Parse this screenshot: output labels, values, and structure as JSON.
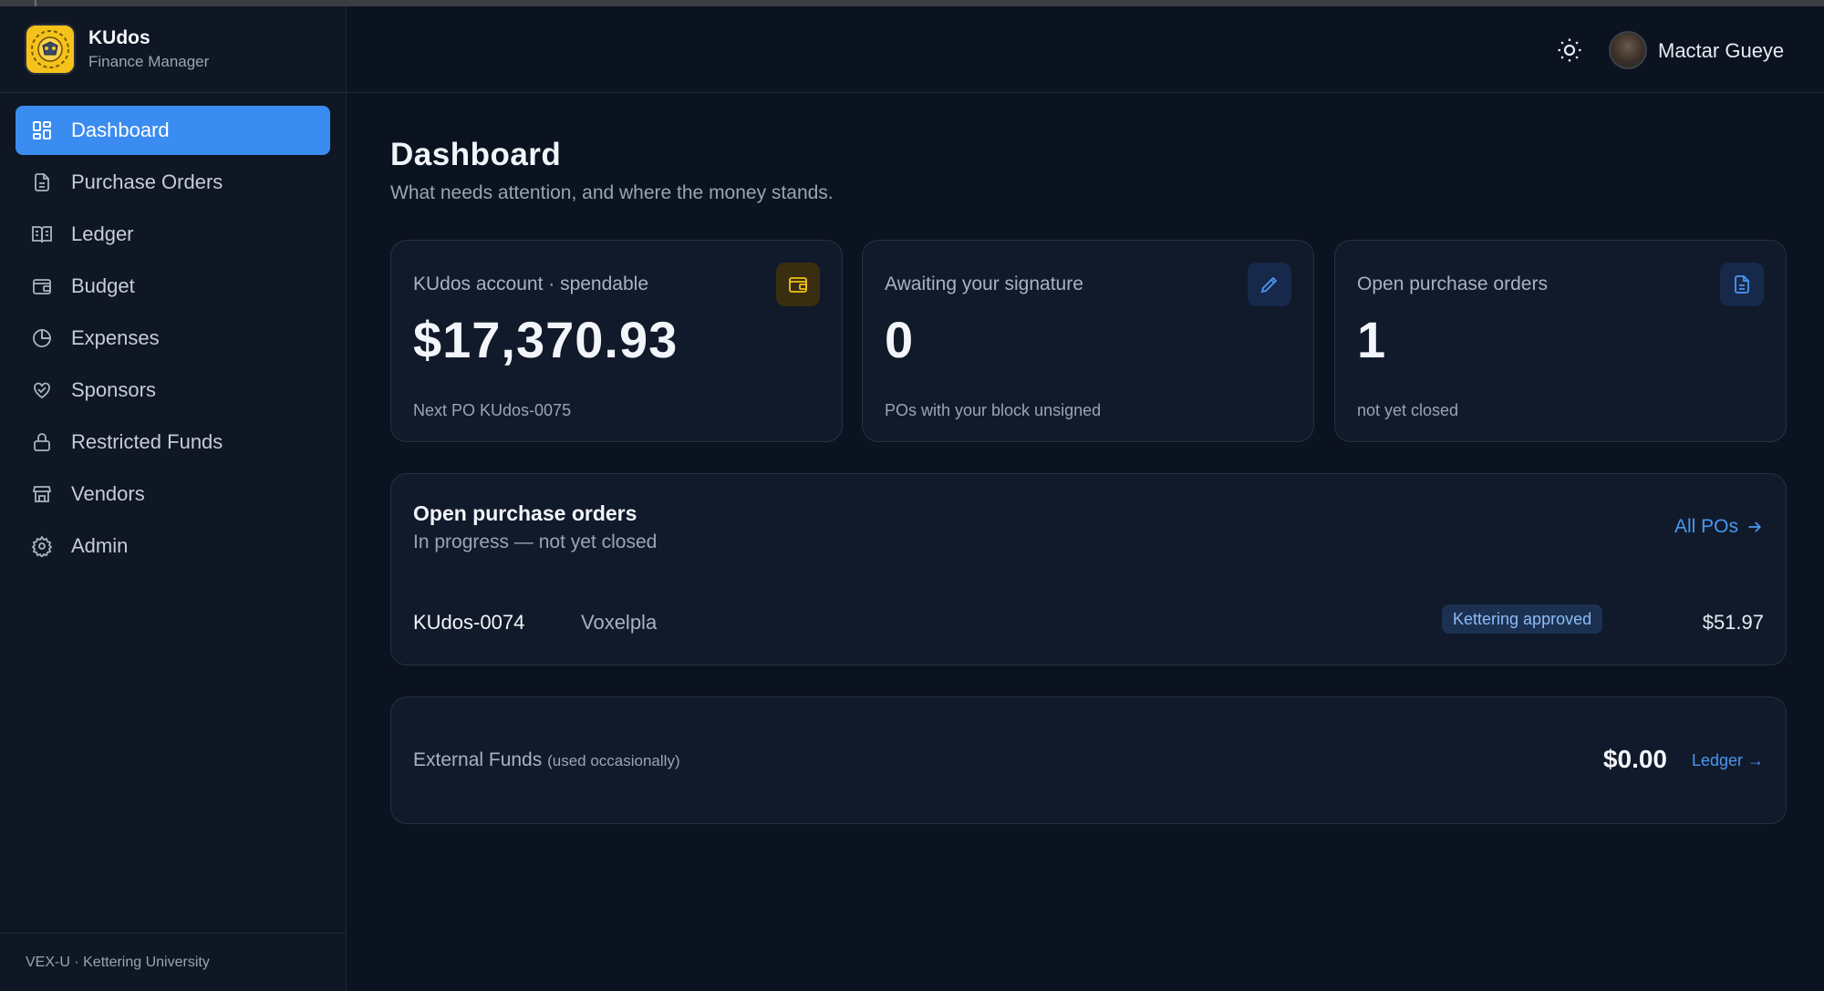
{
  "app": {
    "name": "KUdos",
    "subtitle": "Finance Manager",
    "footer": "VEX-U · Kettering University"
  },
  "sidebar": {
    "items": [
      {
        "label": "Dashboard",
        "icon": "dashboard-icon",
        "active": true
      },
      {
        "label": "Purchase Orders",
        "icon": "document-icon"
      },
      {
        "label": "Ledger",
        "icon": "book-open-icon"
      },
      {
        "label": "Budget",
        "icon": "wallet-icon"
      },
      {
        "label": "Expenses",
        "icon": "pie-chart-icon"
      },
      {
        "label": "Sponsors",
        "icon": "handshake-heart-icon"
      },
      {
        "label": "Restricted Funds",
        "icon": "lock-icon"
      },
      {
        "label": "Vendors",
        "icon": "store-icon"
      },
      {
        "label": "Admin",
        "icon": "gear-icon"
      }
    ]
  },
  "header": {
    "user_name": "Mactar Gueye",
    "theme_icon": "sun-icon"
  },
  "page": {
    "title": "Dashboard",
    "subtitle": "What needs attention, and where the money stands."
  },
  "cards": [
    {
      "label": "KUdos account · spendable",
      "value": "$17,370.93",
      "note": "Next PO KUdos-0075",
      "icon": "wallet-icon",
      "accent": "#f4c21a"
    },
    {
      "label": "Awaiting your signature",
      "value": "0",
      "note": "POs with your block unsigned",
      "icon": "pen-icon",
      "accent": "#4a97f2"
    },
    {
      "label": "Open purchase orders",
      "value": "1",
      "note": "not yet closed",
      "icon": "document-icon",
      "accent": "#4a97f2"
    }
  ],
  "open_pos": {
    "title": "Open purchase orders",
    "subtitle": "In progress — not yet closed",
    "link": "All POs",
    "rows": [
      {
        "id": "KUdos-0074",
        "vendor": "Voxelpla",
        "status": "Kettering approved",
        "amount": "$51.97"
      }
    ]
  },
  "external_funds": {
    "label": "External Funds",
    "note": "(used occasionally)",
    "amount": "$0.00",
    "link": "Ledger →"
  },
  "colors": {
    "accent": "#3b8cf0",
    "link": "#4a97f2",
    "background": "#0b1220",
    "warning": "#f4c21a"
  }
}
